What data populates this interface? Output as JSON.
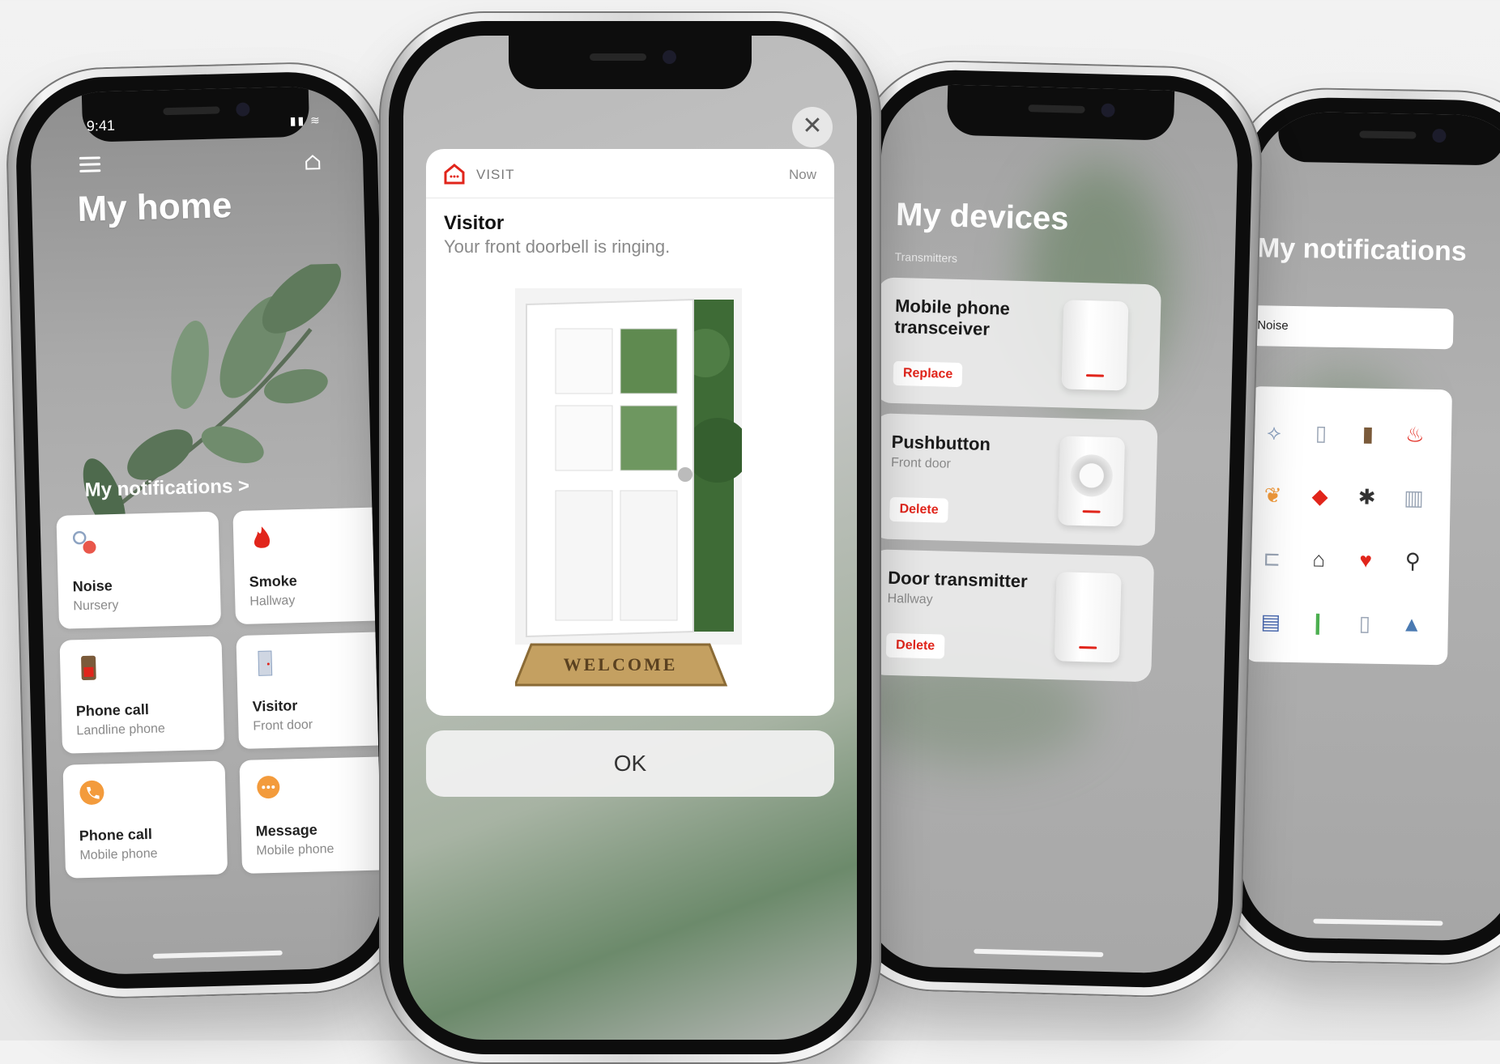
{
  "phone1": {
    "status_time": "9:41",
    "title": "My home",
    "notifications_link": "My notifications >",
    "tiles": [
      {
        "title": "Noise",
        "subtitle": "Nursery",
        "icon": "noise-icon",
        "color": "#e9574b"
      },
      {
        "title": "Smoke",
        "subtitle": "Hallway",
        "icon": "flame-icon",
        "color": "#e1251b"
      },
      {
        "title": "Phone call",
        "subtitle": "Landline phone",
        "icon": "landline-phone-icon",
        "color": "#c0392b"
      },
      {
        "title": "Visitor",
        "subtitle": "Front door",
        "icon": "door-icon",
        "color": "#8da3c2"
      },
      {
        "title": "Phone call",
        "subtitle": "Mobile phone",
        "icon": "mobile-phone-icon",
        "color": "#f39b3c"
      },
      {
        "title": "Message",
        "subtitle": "Mobile phone",
        "icon": "message-icon",
        "color": "#f39b3c"
      }
    ]
  },
  "phone2": {
    "app_name": "VISIT",
    "time": "Now",
    "title": "Visitor",
    "body": "Your front doorbell is ringing.",
    "mat_text": "WELCOME",
    "ok_label": "OK",
    "close_symbol": "✕"
  },
  "phone3": {
    "title": "My devices",
    "section": "Transmitters",
    "devices": [
      {
        "name": "Mobile phone transceiver",
        "location": "",
        "action": "Replace"
      },
      {
        "name": "Pushbutton",
        "location": "Front door",
        "action": "Delete"
      },
      {
        "name": "Door transmitter",
        "location": "Hallway",
        "action": "Delete"
      }
    ]
  },
  "phone4": {
    "title": "My notifications",
    "search_value": "Noise",
    "icons": [
      "noise-icon",
      "door-transmitter-icon",
      "landline-phone-icon",
      "flame-icon",
      "footprint-icon",
      "alarm-icon",
      "fall-icon",
      "intercom-icon",
      "door-open-icon",
      "house-icon",
      "heart-icon",
      "running-person-icon",
      "bed-icon",
      "steps-icon",
      "door-icon",
      "water-drop-icon"
    ]
  },
  "colors": {
    "brand_red": "#e1251b",
    "accent_orange": "#f39b3c"
  }
}
